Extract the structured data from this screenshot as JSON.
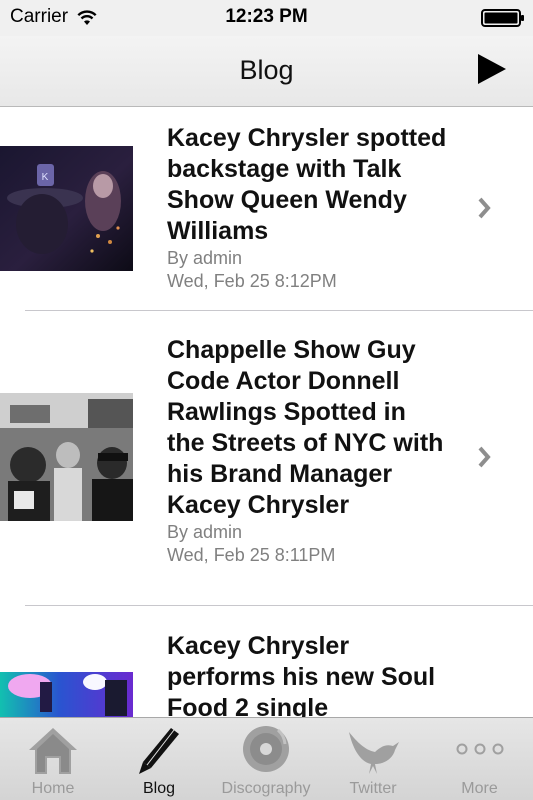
{
  "status_bar": {
    "carrier": "Carrier",
    "time": "12:23 PM"
  },
  "nav": {
    "title": "Blog"
  },
  "posts": [
    {
      "title": "Kacey Chrysler spotted backstage with Talk Show Queen Wendy Williams",
      "author": "By admin",
      "date": "Wed, Feb 25 8:12PM"
    },
    {
      "title": "Chappelle Show Guy Code Actor Donnell Rawlings Spotted in the Streets of NYC with his Brand Manager Kacey Chrysler",
      "author": "By admin",
      "date": "Wed, Feb 25 8:11PM"
    },
    {
      "title": "Kacey Chrysler performs his new Soul Food 2 single",
      "author": "",
      "date": ""
    }
  ],
  "tabs": [
    {
      "label": "Home",
      "icon": "home-icon",
      "active": false
    },
    {
      "label": "Blog",
      "icon": "pencil-icon",
      "active": true
    },
    {
      "label": "Discography",
      "icon": "disc-icon",
      "active": false
    },
    {
      "label": "Twitter",
      "icon": "bird-icon",
      "active": false
    },
    {
      "label": "More",
      "icon": "more-icon",
      "active": false
    }
  ],
  "colors": {
    "active_tab": "#111111",
    "inactive_tab": "#9a9a9a",
    "meta_text": "#808080"
  }
}
